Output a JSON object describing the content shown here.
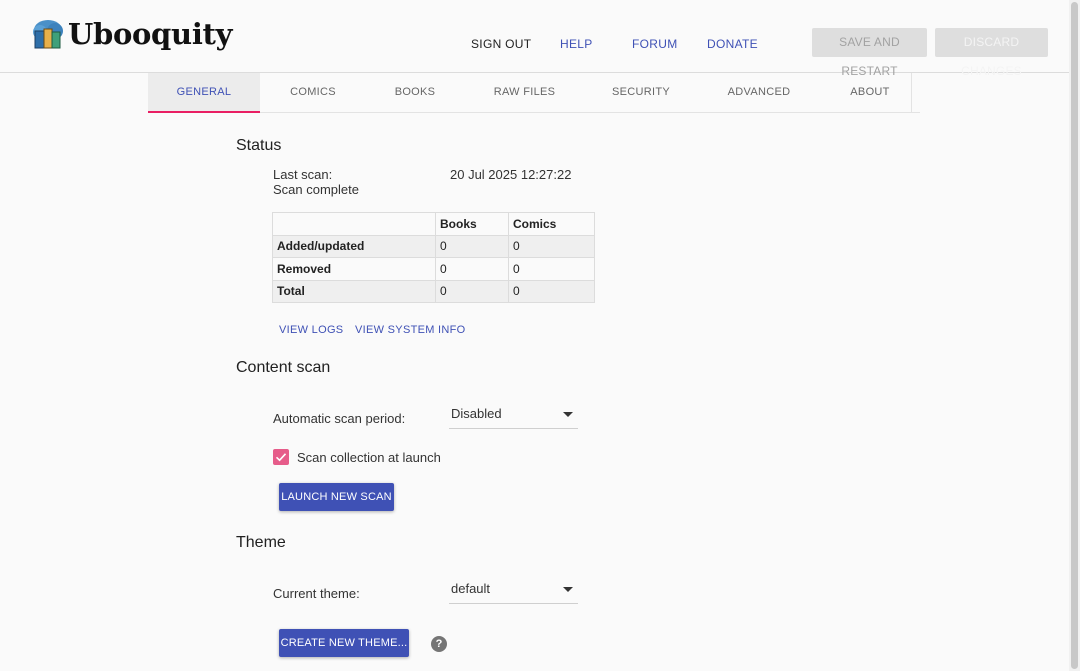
{
  "app": {
    "name": "Ubooquity",
    "logo_icon": "books-cloud-icon"
  },
  "topnav": {
    "sign_out": "SIGN OUT",
    "help": "HELP",
    "forum": "FORUM",
    "donate": "DONATE",
    "save_restart": "SAVE AND RESTART",
    "discard": "DISCARD CHANGES",
    "accent_color": "#3f51b5"
  },
  "tabs": [
    {
      "label": "GENERAL",
      "active": true
    },
    {
      "label": "COMICS"
    },
    {
      "label": "BOOKS"
    },
    {
      "label": "RAW FILES"
    },
    {
      "label": "SECURITY"
    },
    {
      "label": "ADVANCED"
    },
    {
      "label": "ABOUT"
    }
  ],
  "status": {
    "title": "Status",
    "last_scan_label": "Last scan:",
    "last_scan_value": "20 Jul 2025 12:27:22",
    "scan_state": "Scan complete",
    "table": {
      "headers": [
        "",
        "Books",
        "Comics"
      ],
      "rows": [
        {
          "label": "Added/updated",
          "books": "0",
          "comics": "0"
        },
        {
          "label": "Removed",
          "books": "0",
          "comics": "0"
        },
        {
          "label": "Total",
          "books": "0",
          "comics": "0"
        }
      ]
    },
    "view_logs": "VIEW LOGS",
    "view_system_info": "VIEW SYSTEM INFO"
  },
  "content_scan": {
    "title": "Content scan",
    "period_label": "Automatic scan period:",
    "period_value": "Disabled",
    "scan_at_launch_label": "Scan collection at launch",
    "scan_at_launch_checked": true,
    "launch_button": "LAUNCH NEW SCAN"
  },
  "theme": {
    "title": "Theme",
    "current_label": "Current theme:",
    "current_value": "default",
    "create_button": "CREATE NEW THEME...",
    "help_glyph": "?"
  }
}
